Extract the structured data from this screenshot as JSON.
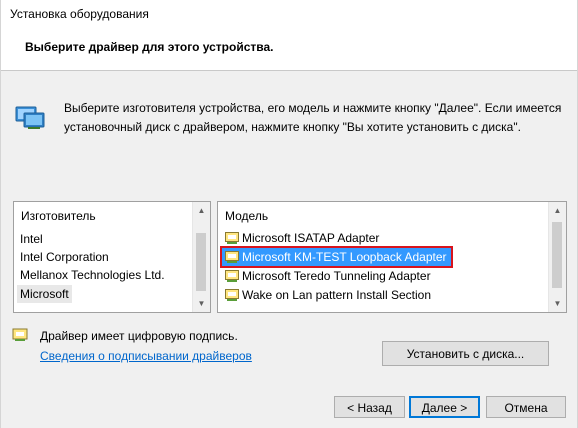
{
  "window": {
    "title": "Установка оборудования",
    "subtitle": "Выберите драйвер для этого устройства."
  },
  "description": {
    "line1": "Выберите изготовителя устройства, его модель и нажмите кнопку \"Далее\". Если имеется",
    "line2": "установочный диск с  драйвером, нажмите кнопку \"Вы хотите установить с диска\"."
  },
  "manufacturers": {
    "header": "Изготовитель",
    "items": [
      "Intel",
      "Intel Corporation",
      "Mellanox Technologies Ltd.",
      "Microsoft"
    ],
    "selected": "Microsoft"
  },
  "models": {
    "header": "Модель",
    "items": [
      "Microsoft ISATAP Adapter",
      "Microsoft KM-TEST Loopback Adapter",
      "Microsoft Teredo Tunneling Adapter",
      "Wake on Lan pattern Install Section"
    ],
    "selected": "Microsoft KM-TEST Loopback Adapter"
  },
  "signature": {
    "text": "Драйвер имеет цифровую подпись.",
    "link": "Сведения о подписывании драйверов"
  },
  "buttons": {
    "install": "Установить с диска...",
    "back": "< Назад",
    "next": "Далее >",
    "cancel": "Отмена"
  },
  "colors": {
    "selection": "#3399ff",
    "highlight_box": "#d8141d",
    "link": "#0066cc"
  }
}
